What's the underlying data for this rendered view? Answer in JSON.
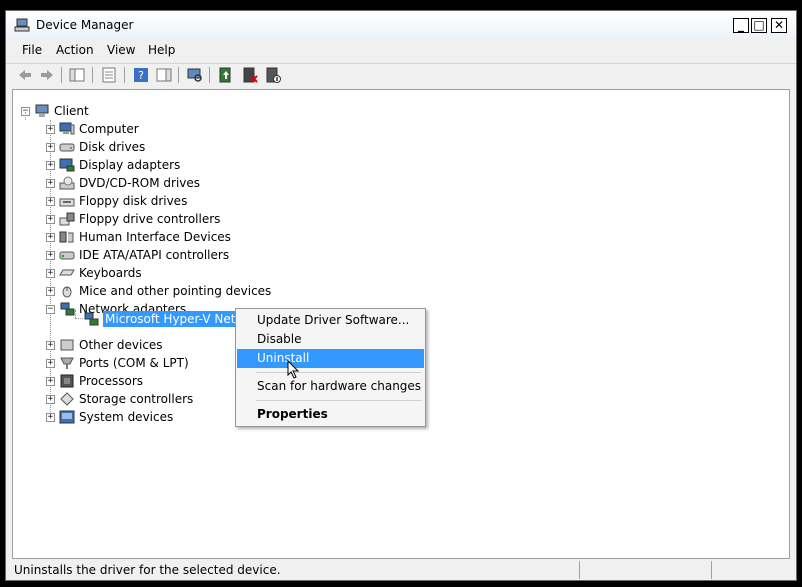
{
  "window": {
    "title": "Device Manager"
  },
  "menu": [
    "File",
    "Action",
    "View",
    "Help"
  ],
  "toolbar_icons": [
    "back-icon",
    "forward-icon",
    "console-tree-icon",
    "properties-icon",
    "help-icon",
    "action-pane-icon",
    "scan-hardware-icon",
    "update-driver-icon",
    "uninstall-icon",
    "disable-icon"
  ],
  "tree": {
    "root": "Client",
    "items": [
      {
        "label": "Computer",
        "icon": "computer-icon",
        "expanded": false
      },
      {
        "label": "Disk drives",
        "icon": "disk-drive-icon",
        "expanded": false
      },
      {
        "label": "Display adapters",
        "icon": "display-adapter-icon",
        "expanded": false
      },
      {
        "label": "DVD/CD-ROM drives",
        "icon": "dvd-drive-icon",
        "expanded": false
      },
      {
        "label": "Floppy disk drives",
        "icon": "floppy-icon",
        "expanded": false
      },
      {
        "label": "Floppy drive controllers",
        "icon": "floppy-controller-icon",
        "expanded": false
      },
      {
        "label": "Human Interface Devices",
        "icon": "hid-icon",
        "expanded": false
      },
      {
        "label": "IDE ATA/ATAPI controllers",
        "icon": "ide-controller-icon",
        "expanded": false
      },
      {
        "label": "Keyboards",
        "icon": "keyboard-icon",
        "expanded": false
      },
      {
        "label": "Mice and other pointing devices",
        "icon": "mouse-icon",
        "expanded": false
      },
      {
        "label": "Network adapters",
        "icon": "network-adapter-icon",
        "expanded": true,
        "children": [
          {
            "label": "Microsoft Hyper-V Network Adapter",
            "visible_label": "Microsoft Hyper-V Networ"
          }
        ]
      },
      {
        "label": "Other devices",
        "icon": "other-devices-icon",
        "expanded": false
      },
      {
        "label": "Ports (COM & LPT)",
        "icon": "port-icon",
        "expanded": false
      },
      {
        "label": "Processors",
        "icon": "processor-icon",
        "expanded": false
      },
      {
        "label": "Storage controllers",
        "icon": "storage-controller-icon",
        "expanded": false
      },
      {
        "label": "System devices",
        "icon": "system-devices-icon",
        "expanded": false
      }
    ]
  },
  "context_menu": {
    "update_driver": "Update Driver Software...",
    "disable": "Disable",
    "uninstall": "Uninstall",
    "scan": "Scan for hardware changes",
    "properties": "Properties"
  },
  "status": {
    "text": "Uninstalls the driver for the selected device."
  },
  "colors": {
    "selection": "#3399ff",
    "window_bg": "#f0f0f0"
  }
}
